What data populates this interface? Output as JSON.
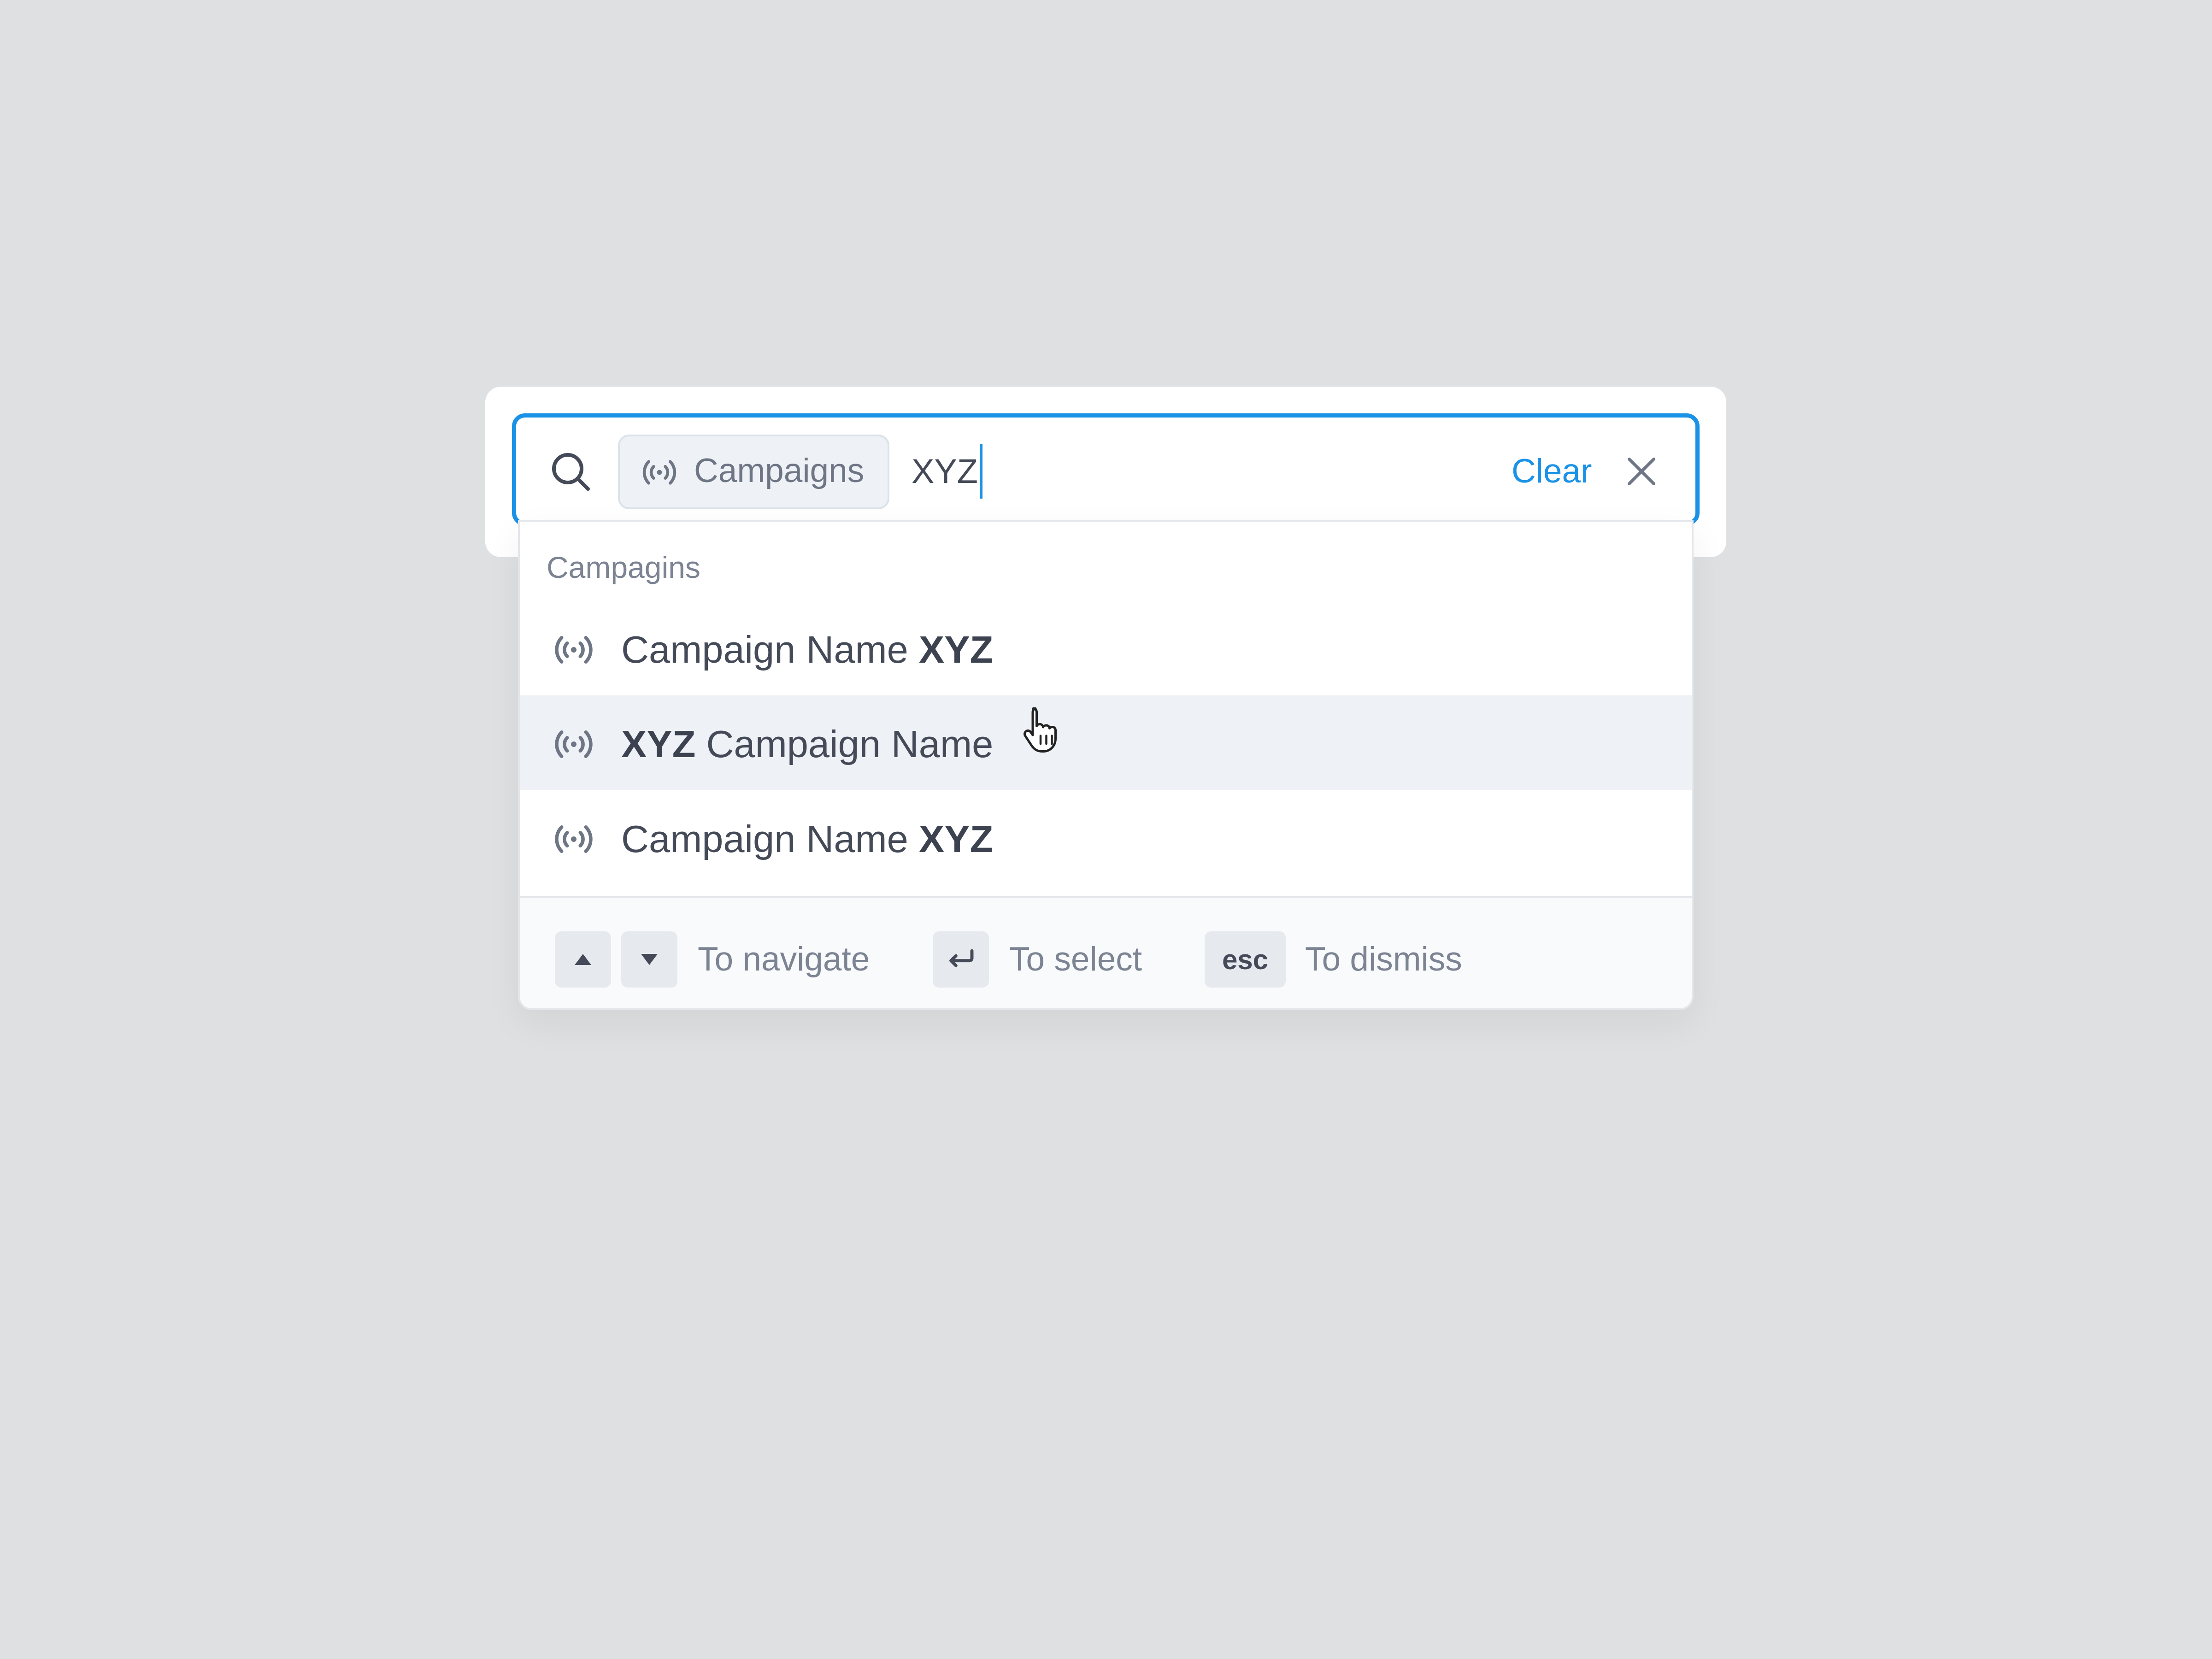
{
  "search": {
    "scope_chip": {
      "label": "Campaigns",
      "icon": "broadcast-icon"
    },
    "query": "XYZ",
    "clear_label": "Clear",
    "icons": {
      "search": "search-icon",
      "close": "close-icon"
    }
  },
  "dropdown": {
    "group_label": "Campagins",
    "results": [
      {
        "pre": "Campaign Name ",
        "match": "XYZ",
        "post": "",
        "icon": "broadcast-icon",
        "hovered": false
      },
      {
        "pre": "",
        "match": "XYZ",
        "post": " Campaign Name",
        "icon": "broadcast-icon",
        "hovered": true
      },
      {
        "pre": "Campaign Name ",
        "match": "XYZ",
        "post": "",
        "icon": "broadcast-icon",
        "hovered": false
      }
    ],
    "footer": {
      "navigate_hint": "To navigate",
      "select_hint": "To select",
      "esc_key": "esc",
      "dismiss_hint": "To dismiss"
    }
  },
  "colors": {
    "accent": "#1a92e6",
    "background": "#dfe0e2",
    "text": "#454a58",
    "muted": "#7c8393",
    "hover_row": "#eef2f6"
  }
}
